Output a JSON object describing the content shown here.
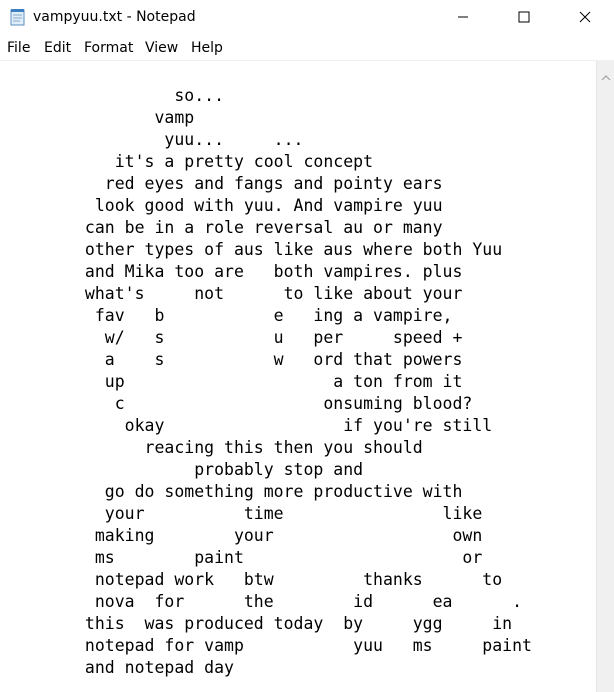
{
  "window": {
    "title": "vampyuu.txt - Notepad",
    "icon": "notepad-icon",
    "controls": {
      "minimize_icon": "minimize-icon",
      "maximize_icon": "maximize-icon",
      "close_icon": "close-icon"
    }
  },
  "menu": {
    "file": "File",
    "edit": "Edit",
    "format": "Format",
    "view": "View",
    "help": "Help"
  },
  "editor": {
    "content": "          so...\n        vamp\n         yuu...     ...\n    it's a pretty cool concept\n   red eyes and fangs and pointy ears\n  look good with yuu. And vampire yuu\n can be in a role reversal au or many\n other types of aus like aus where both Yuu\n and Mika too are   both vampires. plus\n what's     not      to like about your\n  fav   b           e   ing a vampire,\n   w/   s           u   per     speed +\n   a    s           w   ord that powers\n   up                     a ton from it\n    c                    onsuming blood?\n     okay                  if you're still\n       reacing this then you should\n            probably stop and\n   go do something more productive with\n   your          time                like\n  making        your                  own\n  ms        paint                      or\n  notepad work   btw         thanks      to\n  nova  for      the        id      ea      .\n this  was produced today  by     ygg     in\n notepad for vamp           yuu   ms     paint\n and notepad day"
  },
  "scrollbar": {
    "up_icon": "scroll-up-arrow-icon"
  }
}
